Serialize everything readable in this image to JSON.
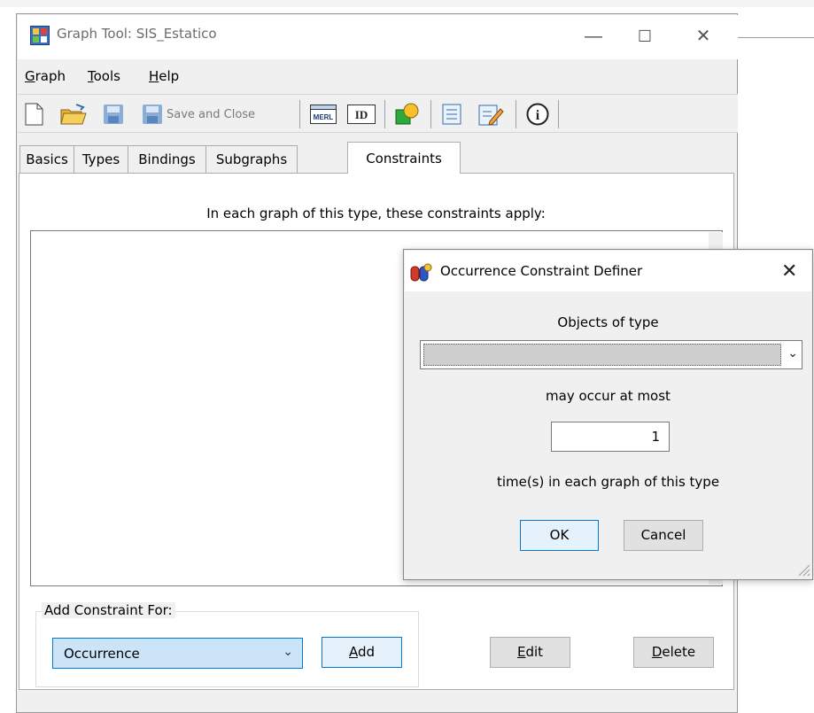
{
  "main_window": {
    "title": "Graph Tool: SIS_Estatico",
    "minimize": "—",
    "maximize": "☐",
    "close": "✕"
  },
  "menu": [
    {
      "label": "Graph",
      "accel": "G",
      "rest": "raph"
    },
    {
      "label": "Tools",
      "accel": "T",
      "rest": "ools"
    },
    {
      "label": "Help",
      "accel": "H",
      "rest": "elp"
    }
  ],
  "toolbar": {
    "save_and_close_label": "Save and Close",
    "icons": [
      "new-file-icon",
      "open-folder-icon",
      "save-icon",
      "save-and-close-icon",
      "merl-icon",
      "id-icon",
      "object-types-icon",
      "list-icon",
      "edit-icon",
      "info-icon"
    ],
    "merl_text": "MERL",
    "id_text": "ID",
    "info_text": "i"
  },
  "tabs": [
    {
      "label": "Basics"
    },
    {
      "label": "Types"
    },
    {
      "label": "Bindings"
    },
    {
      "label": "Subgraphs"
    },
    {
      "label": "Constraints",
      "active": true
    }
  ],
  "constraints_panel": {
    "heading": "In each graph of this type, these constraints apply:",
    "items": [],
    "group_label": "Add Constraint For:",
    "constraint_type": "Occurrence",
    "add_label": "Add",
    "add_accel": "A",
    "add_rest": "dd",
    "edit_label": "Edit",
    "edit_accel": "E",
    "edit_rest": "dit",
    "delete_label": "Delete",
    "delete_accel": "D",
    "delete_rest": "elete"
  },
  "dialog": {
    "title": "Occurrence Constraint Definer",
    "close": "✕",
    "objects_label": "Objects of type",
    "objects_value": "",
    "may_occur_label": "may occur at most",
    "count_value": "1",
    "times_label": "time(s) in each graph of this type",
    "ok_label": "OK",
    "cancel_label": "Cancel"
  },
  "colors": {
    "window_bg": "#f0f0f0",
    "selection_blue": "#cce4f7",
    "focus_border": "#0078d7"
  }
}
